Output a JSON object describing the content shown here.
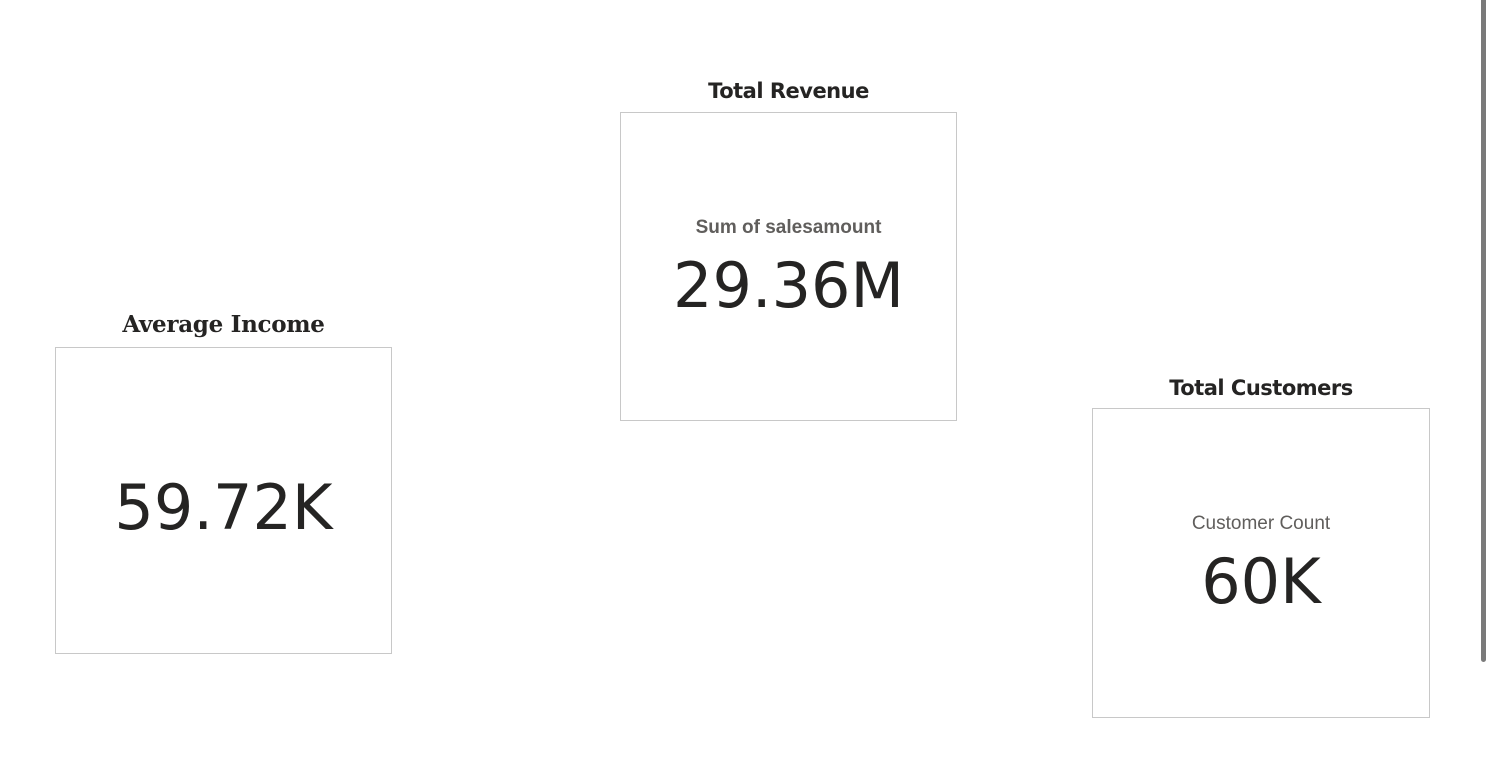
{
  "cards": {
    "total_revenue": {
      "title": "Total Revenue",
      "label": "Sum of salesamount",
      "value": "29.36M"
    },
    "average_income": {
      "title": "Average Income",
      "value": "59.72K"
    },
    "total_customers": {
      "title": "Total Customers",
      "label": "Customer Count",
      "value": "60K"
    }
  },
  "colors": {
    "background": "#ffffff",
    "value_text": "#252423",
    "label_text": "#605e5c",
    "card_border": "#c8c8c8",
    "scrollbar": "#7a7a7a"
  }
}
